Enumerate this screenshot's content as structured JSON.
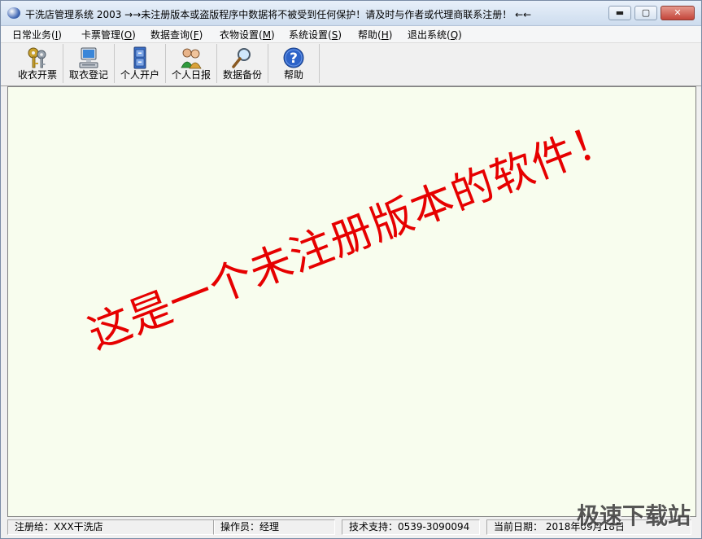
{
  "window": {
    "title": "干洗店管理系统 2003  →→未注册版本或盗版程序中数据将不被受到任何保护！请及时与作者或代理商联系注册！ ←←",
    "min_glyph": "▬",
    "max_glyph": "▢",
    "close_glyph": "✕"
  },
  "menu": [
    {
      "label": "日常业务(",
      "key": "I",
      "tail": ")"
    },
    {
      "label": "卡票管理(",
      "key": "O",
      "tail": ")"
    },
    {
      "label": "数据查询(",
      "key": "F",
      "tail": ")"
    },
    {
      "label": "衣物设置(",
      "key": "M",
      "tail": ")"
    },
    {
      "label": "系统设置(",
      "key": "S",
      "tail": ")"
    },
    {
      "label": "帮助(",
      "key": "H",
      "tail": ")"
    },
    {
      "label": "退出系统(",
      "key": "Q",
      "tail": ")"
    }
  ],
  "toolbar": [
    {
      "label": "收衣开票",
      "icon": "keys-icon"
    },
    {
      "label": "取衣登记",
      "icon": "computer-icon"
    },
    {
      "label": "个人开户",
      "icon": "cabinet-icon"
    },
    {
      "label": "个人日报",
      "icon": "people-icon"
    },
    {
      "label": "数据备份",
      "icon": "magnifier-icon"
    },
    {
      "label": "帮助",
      "icon": "help-icon"
    }
  ],
  "watermark": "这是一个未注册版本的软件！",
  "status": {
    "registered_to": "注册给：XXX干洗店",
    "operator": "操作员：经理",
    "support": "技术支持：0539-3090094",
    "date": "当前日期： 2018年09月18日"
  },
  "site_logo": "极速下载站",
  "colors": {
    "workarea_bg": "#f8fdee",
    "watermark": "#e60000"
  }
}
